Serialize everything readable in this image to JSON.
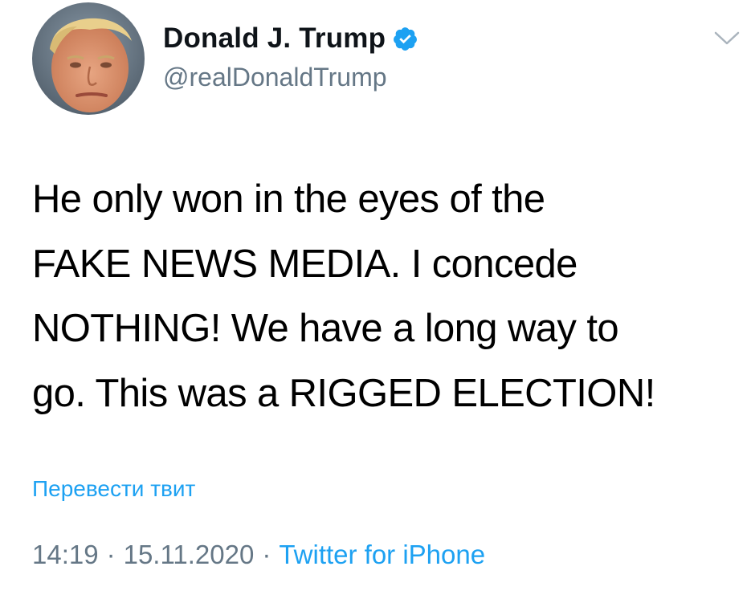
{
  "user": {
    "display_name": "Donald J. Trump",
    "handle": "@realDonaldTrump",
    "verified": true,
    "avatar_icon": "profile-photo-icon"
  },
  "tweet": {
    "text": "He only won in the eyes of the\nFAKE NEWS MEDIA. I concede\nNOTHING! We have a long way to\ngo. This was a RIGGED ELECTION!",
    "translate_label": "Перевести твит",
    "time": "14:19",
    "date": "15.11.2020",
    "separator": "·",
    "source": "Twitter for iPhone"
  },
  "icons": {
    "verified": "verified-badge-icon",
    "more": "chevron-down-icon"
  },
  "colors": {
    "accent": "#1da1f2",
    "secondary_text": "#657786",
    "primary_text": "#000000"
  }
}
